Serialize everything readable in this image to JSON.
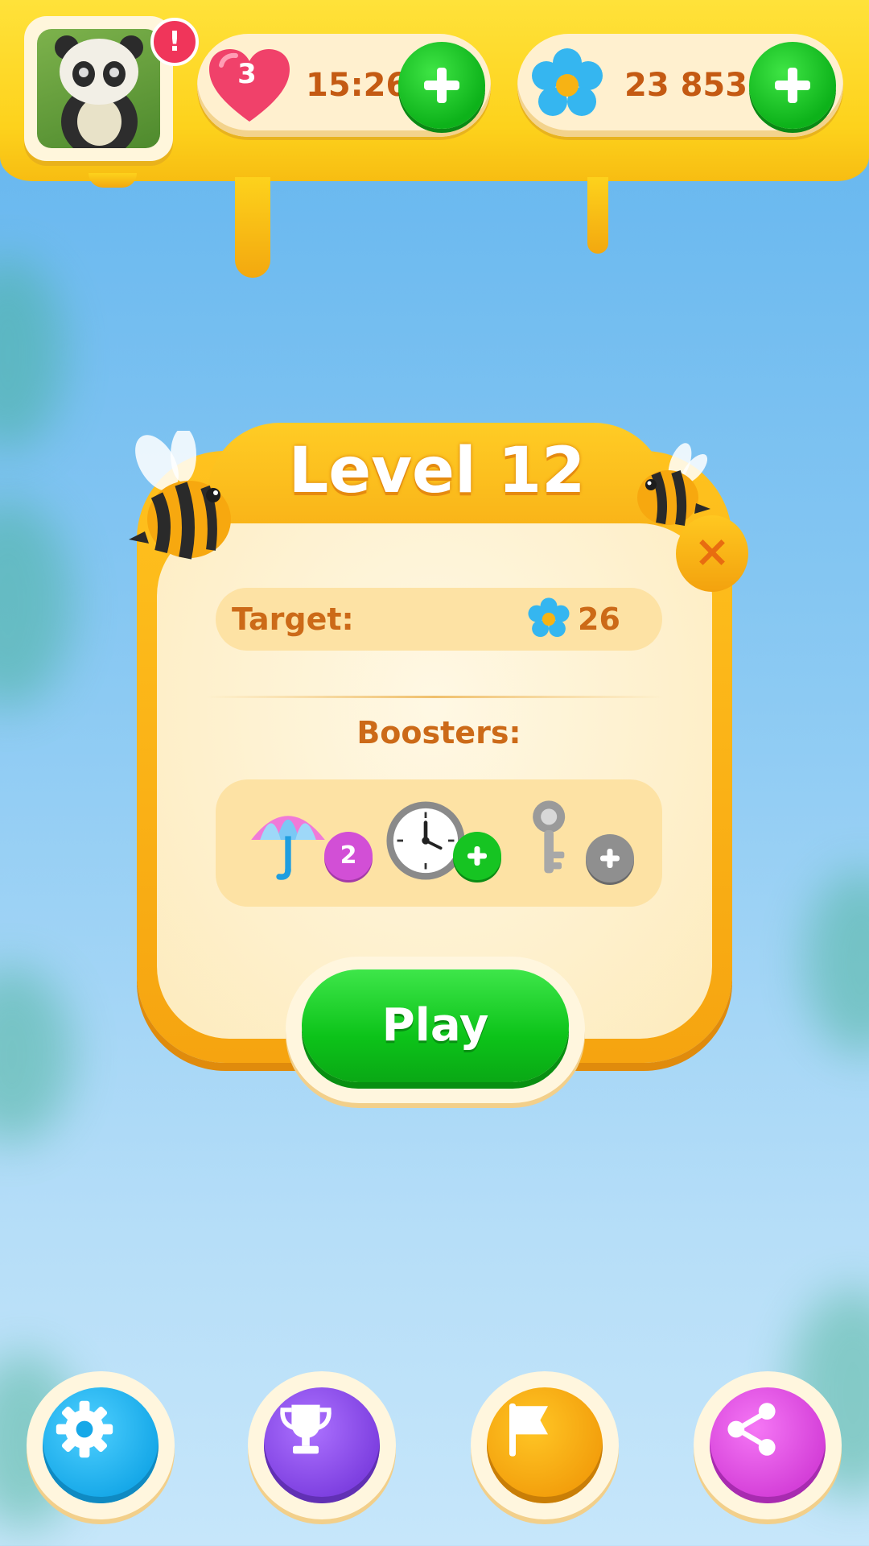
{
  "hud": {
    "lives": "3",
    "lives_timer": "15:26",
    "coins": "23 853",
    "notification": "!"
  },
  "level_panel": {
    "title": "Level 12",
    "close": "×",
    "target_label": "Target:",
    "target_value": "26",
    "target_icon": "flower-icon",
    "boosters_label": "Boosters:",
    "boosters": [
      {
        "icon": "umbrella-icon",
        "badge": "2",
        "badge_type": "count"
      },
      {
        "icon": "clock-icon",
        "badge": "+",
        "badge_type": "add"
      },
      {
        "icon": "key-icon",
        "badge": "+",
        "badge_type": "locked-add"
      }
    ],
    "play_label": "Play"
  },
  "bottom_nav": [
    {
      "icon": "gear-icon",
      "color": "#1fb6f0"
    },
    {
      "icon": "trophy-icon",
      "color": "#8e4de8"
    },
    {
      "icon": "flag-icon",
      "color": "#f7a80f"
    },
    {
      "icon": "share-icon",
      "color": "#e04fe0"
    }
  ],
  "colors": {
    "honey": "#fdd21c",
    "accent_text": "#cc6a18",
    "play_green": "#0cc319",
    "sky": "#8ccaf3"
  }
}
